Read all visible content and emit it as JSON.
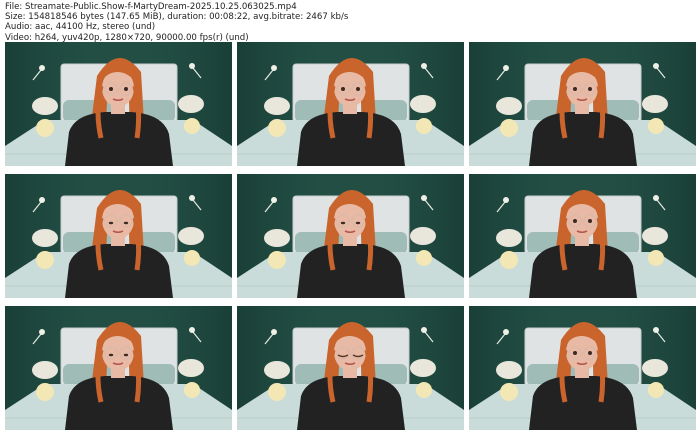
{
  "info": {
    "file_line": "File: Streamate-Public.Show-f-MartyDream-2025.10.25.063025.mp4",
    "size_line": "Size: 154818546 bytes (147.65 MiB), duration: 00:08:22, avg.bitrate: 2467 kb/s",
    "audio_line": "Audio: aac, 44100 Hz, stereo (und)",
    "video_line": "Video: h264, yuv420p, 1280×720, 90000.00 fps(r) (und)"
  },
  "thumbnails": [
    {
      "id": 1,
      "eyes": "open"
    },
    {
      "id": 2,
      "eyes": "open"
    },
    {
      "id": 3,
      "eyes": "open"
    },
    {
      "id": 4,
      "eyes": "down"
    },
    {
      "id": 5,
      "eyes": "down"
    },
    {
      "id": 6,
      "eyes": "open"
    },
    {
      "id": 7,
      "eyes": "down"
    },
    {
      "id": 8,
      "eyes": "closed"
    },
    {
      "id": 9,
      "eyes": "open"
    }
  ],
  "colors": {
    "wall": "#1f4a40",
    "bed": "#c9dcd9",
    "headboard": "#dfe3e3",
    "hair": "#c8642c",
    "shirt": "#222222",
    "skin": "#e8b9a5",
    "lamp": "#f3e8b5"
  }
}
